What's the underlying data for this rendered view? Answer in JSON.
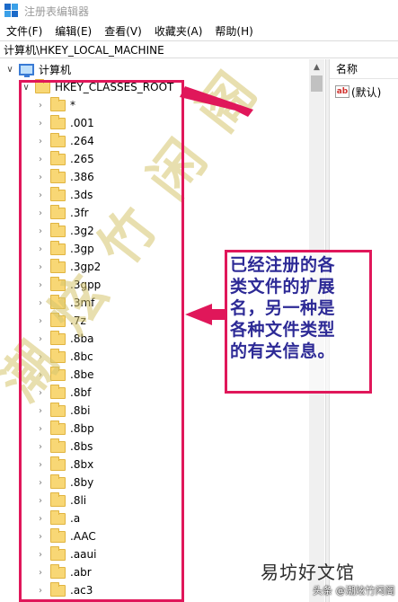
{
  "window": {
    "title": "注册表编辑器"
  },
  "menu": [
    "文件(F)",
    "编辑(E)",
    "查看(V)",
    "收藏夹(A)",
    "帮助(H)"
  ],
  "address": "计算机\\HKEY_LOCAL_MACHINE",
  "tree": {
    "root": "计算机",
    "hive": "HKEY_CLASSES_ROOT",
    "children": [
      "*",
      ".001",
      ".264",
      ".265",
      ".386",
      ".3ds",
      ".3fr",
      ".3g2",
      ".3gp",
      ".3gp2",
      ".3gpp",
      ".3mf",
      ".7z",
      ".8ba",
      ".8bc",
      ".8be",
      ".8bf",
      ".8bi",
      ".8bp",
      ".8bs",
      ".8bx",
      ".8by",
      ".8li",
      ".a",
      ".AAC",
      ".aaui",
      ".abr",
      ".ac3"
    ]
  },
  "right_pane": {
    "column_header": "名称",
    "value_icon_label": "ab",
    "value_name": "(默认)"
  },
  "annotation": {
    "lines": [
      "已经注册的各",
      "类文件的扩展",
      "名，另一种是",
      "各种文件类型",
      "的有关信息。"
    ],
    "color": "#e0175a",
    "text_color": "#2d2a96"
  },
  "watermark": {
    "text": "潮炫竹闲阁"
  },
  "brand": {
    "text": "易坊好文馆",
    "handle": "头条 @潮炫竹闲阁"
  }
}
